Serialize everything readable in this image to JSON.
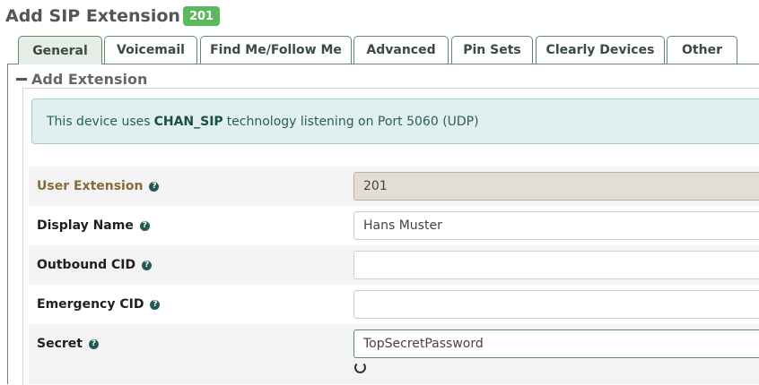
{
  "header": {
    "title": "Add SIP Extension",
    "badge": "201"
  },
  "tabs": [
    {
      "label": "General",
      "active": true
    },
    {
      "label": "Voicemail",
      "active": false
    },
    {
      "label": "Find Me/Follow Me",
      "active": false
    },
    {
      "label": "Advanced",
      "active": false
    },
    {
      "label": "Pin Sets",
      "active": false
    },
    {
      "label": "Clearly Devices",
      "active": false
    },
    {
      "label": "Other",
      "active": false
    }
  ],
  "section": {
    "title": "Add Extension"
  },
  "alert": {
    "prefix": "This device uses",
    "tech": "CHAN_SIP",
    "suffix": "technology listening on Port 5060 (UDP)"
  },
  "fields": {
    "user_extension": {
      "label": "User Extension",
      "value": "201"
    },
    "display_name": {
      "label": "Display Name",
      "value": "Hans Muster"
    },
    "outbound_cid": {
      "label": "Outbound CID",
      "value": ""
    },
    "emergency_cid": {
      "label": "Emergency CID",
      "value": ""
    },
    "secret": {
      "label": "Secret",
      "value": "TopSecretPassword"
    }
  },
  "help_glyph": "?",
  "colors": {
    "accent_green": "#5cb85c",
    "tab_border": "#5d8a68",
    "alert_bg": "#dff0ee",
    "readonly_bg": "#e3ded4"
  }
}
